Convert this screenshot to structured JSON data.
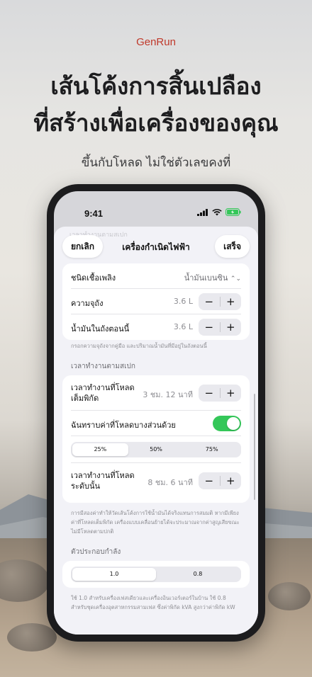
{
  "brand": "GenRun",
  "headline": [
    "เส้นโค้งการสิ้นเปลือง",
    "ที่สร้างเพื่อเครื่องของคุณ"
  ],
  "subhead": "ขึ้นกับโหลด ไม่ใช่ตัวเลขคงที่",
  "status": {
    "time": "9:41",
    "battery_color": "#34c759"
  },
  "nav": {
    "cancel": "ยกเลิก",
    "title": "เครื่องกำเนิดไฟฟ้า",
    "done": "เสร็จ"
  },
  "fuel_card": {
    "fuel_type_label": "ชนิดเชื้อเพลิง",
    "fuel_type_value": "น้ำมันเบนซิน",
    "capacity_label": "ความจุถัง",
    "capacity_value": "3.6 L",
    "tank_now_label": "น้ำมันในถังตอนนี้",
    "tank_now_value": "3.6 L"
  },
  "fuel_footnote": "กรอกความจุถังจากคู่มือ และปริมาณน้ำมันที่มีอยู่ในถังตอนนี้",
  "runtime_section": "เวลาทำงานตามสเปก",
  "runtime_card": {
    "full_load_label": [
      "เวลาทำงานที่โหลด",
      "เต็มพิกัด"
    ],
    "full_load_value": "3 ชม. 12 นาที",
    "partial_toggle_label": "ฉันทราบค่าที่โหลดบางส่วนด้วย",
    "partial_toggle_on": true,
    "load_options": [
      "25%",
      "50%",
      "75%"
    ],
    "selected_load": "25%",
    "level_label": [
      "เวลาทำงานที่โหลด",
      "ระดับนั้น"
    ],
    "level_value": "8 ชม. 6 นาที"
  },
  "runtime_footnote": "การมีสองค่าทำให้วัดเส้นโค้งการใช้น้ำมันได้จริงแทนการสมมติ หากมีเพียงค่าที่โหลดเต็มพิกัด เครื่องแบบเคลื่อนย้ายได้จะประมาณจากค่าสูญเสียขณะไม่มีโหลดตามปกติ",
  "pf_section": "ตัวประกอบกำลัง",
  "pf_options": [
    "1.0",
    "0.8"
  ],
  "pf_selected": "1.0",
  "pf_footnote": "ใช้ 1.0 สำหรับเครื่องเฟสเดียวและเครื่องอินเวอร์เตอร์ในบ้าน ใช้ 0.8 สำหรับชุดเครื่องอุตสาหกรรมสามเฟส ซึ่งค่าพิกัด kVA สูงกว่าค่าพิกัด kW",
  "ghost_text": "เวลาทำงานตามสเปก"
}
